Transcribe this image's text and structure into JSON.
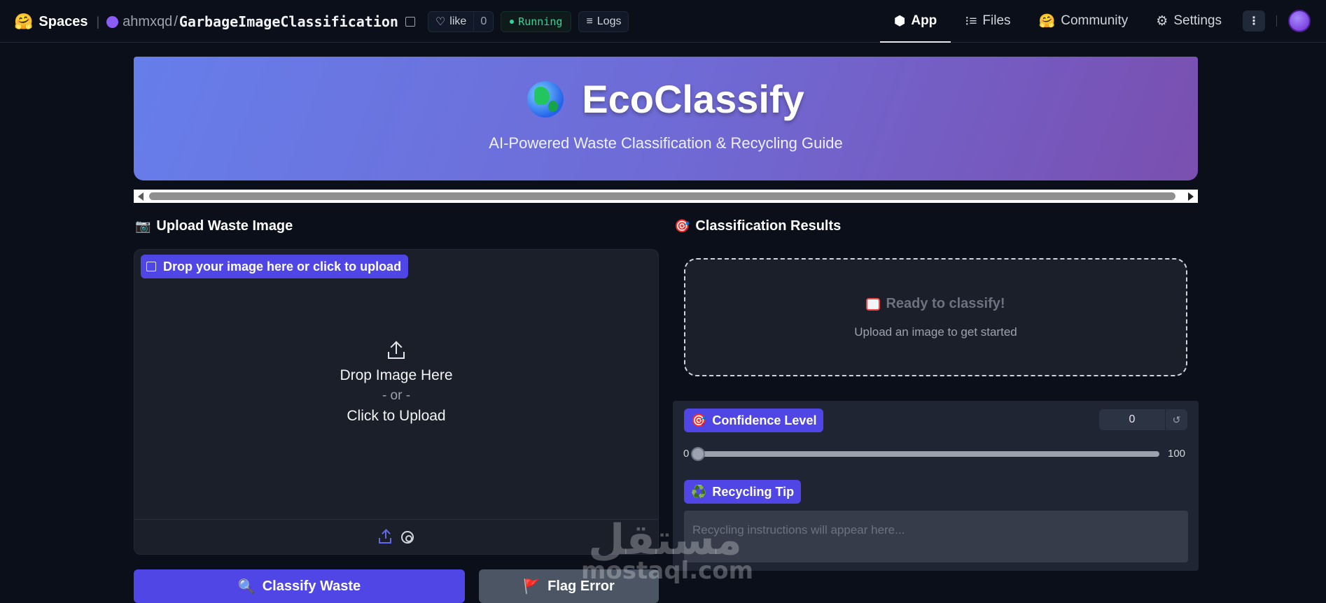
{
  "topbar": {
    "spaces_label": "Spaces",
    "owner": "ahmxqd",
    "separator": "/",
    "repo": "GarbageImageClassification",
    "like_label": "like",
    "like_count": "0",
    "status": "Running",
    "logs_label": "Logs",
    "tabs": [
      {
        "label": "App",
        "icon": "cube-icon",
        "active": true
      },
      {
        "label": "Files",
        "icon": "files-icon",
        "active": false
      },
      {
        "label": "Community",
        "icon": "community-icon",
        "active": false
      },
      {
        "label": "Settings",
        "icon": "gear-icon",
        "active": false
      }
    ]
  },
  "hero": {
    "title": "EcoClassify",
    "subtitle": "AI-Powered Waste Classification & Recycling Guide",
    "icon": "globe-icon"
  },
  "upload_section": {
    "heading": "Upload Waste Image",
    "heading_icon": "📷",
    "label": "Drop your image here or click to upload",
    "drop_line1": "Drop Image Here",
    "drop_or": "- or -",
    "drop_line2": "Click to Upload"
  },
  "buttons": {
    "classify_label": "Classify Waste",
    "classify_icon": "🔍",
    "flag_label": "Flag Error",
    "flag_icon": "🚩"
  },
  "results_section": {
    "heading": "Classification Results",
    "heading_icon": "🎯",
    "ready_text": "Ready to classify!",
    "hint": "Upload an image to get started"
  },
  "confidence": {
    "label": "Confidence Level",
    "icon": "🎯",
    "value": "0",
    "min": "0",
    "max": "100",
    "level_fraction": 0
  },
  "recycling": {
    "label": "Recycling Tip",
    "icon": "♻️",
    "placeholder": "Recycling instructions will appear here..."
  },
  "watermark": {
    "arabic": "مستقل",
    "latin": "mostaql.com"
  },
  "colors": {
    "accent": "#4f46e5",
    "background": "#0b0f19",
    "status_green": "#34d399"
  }
}
